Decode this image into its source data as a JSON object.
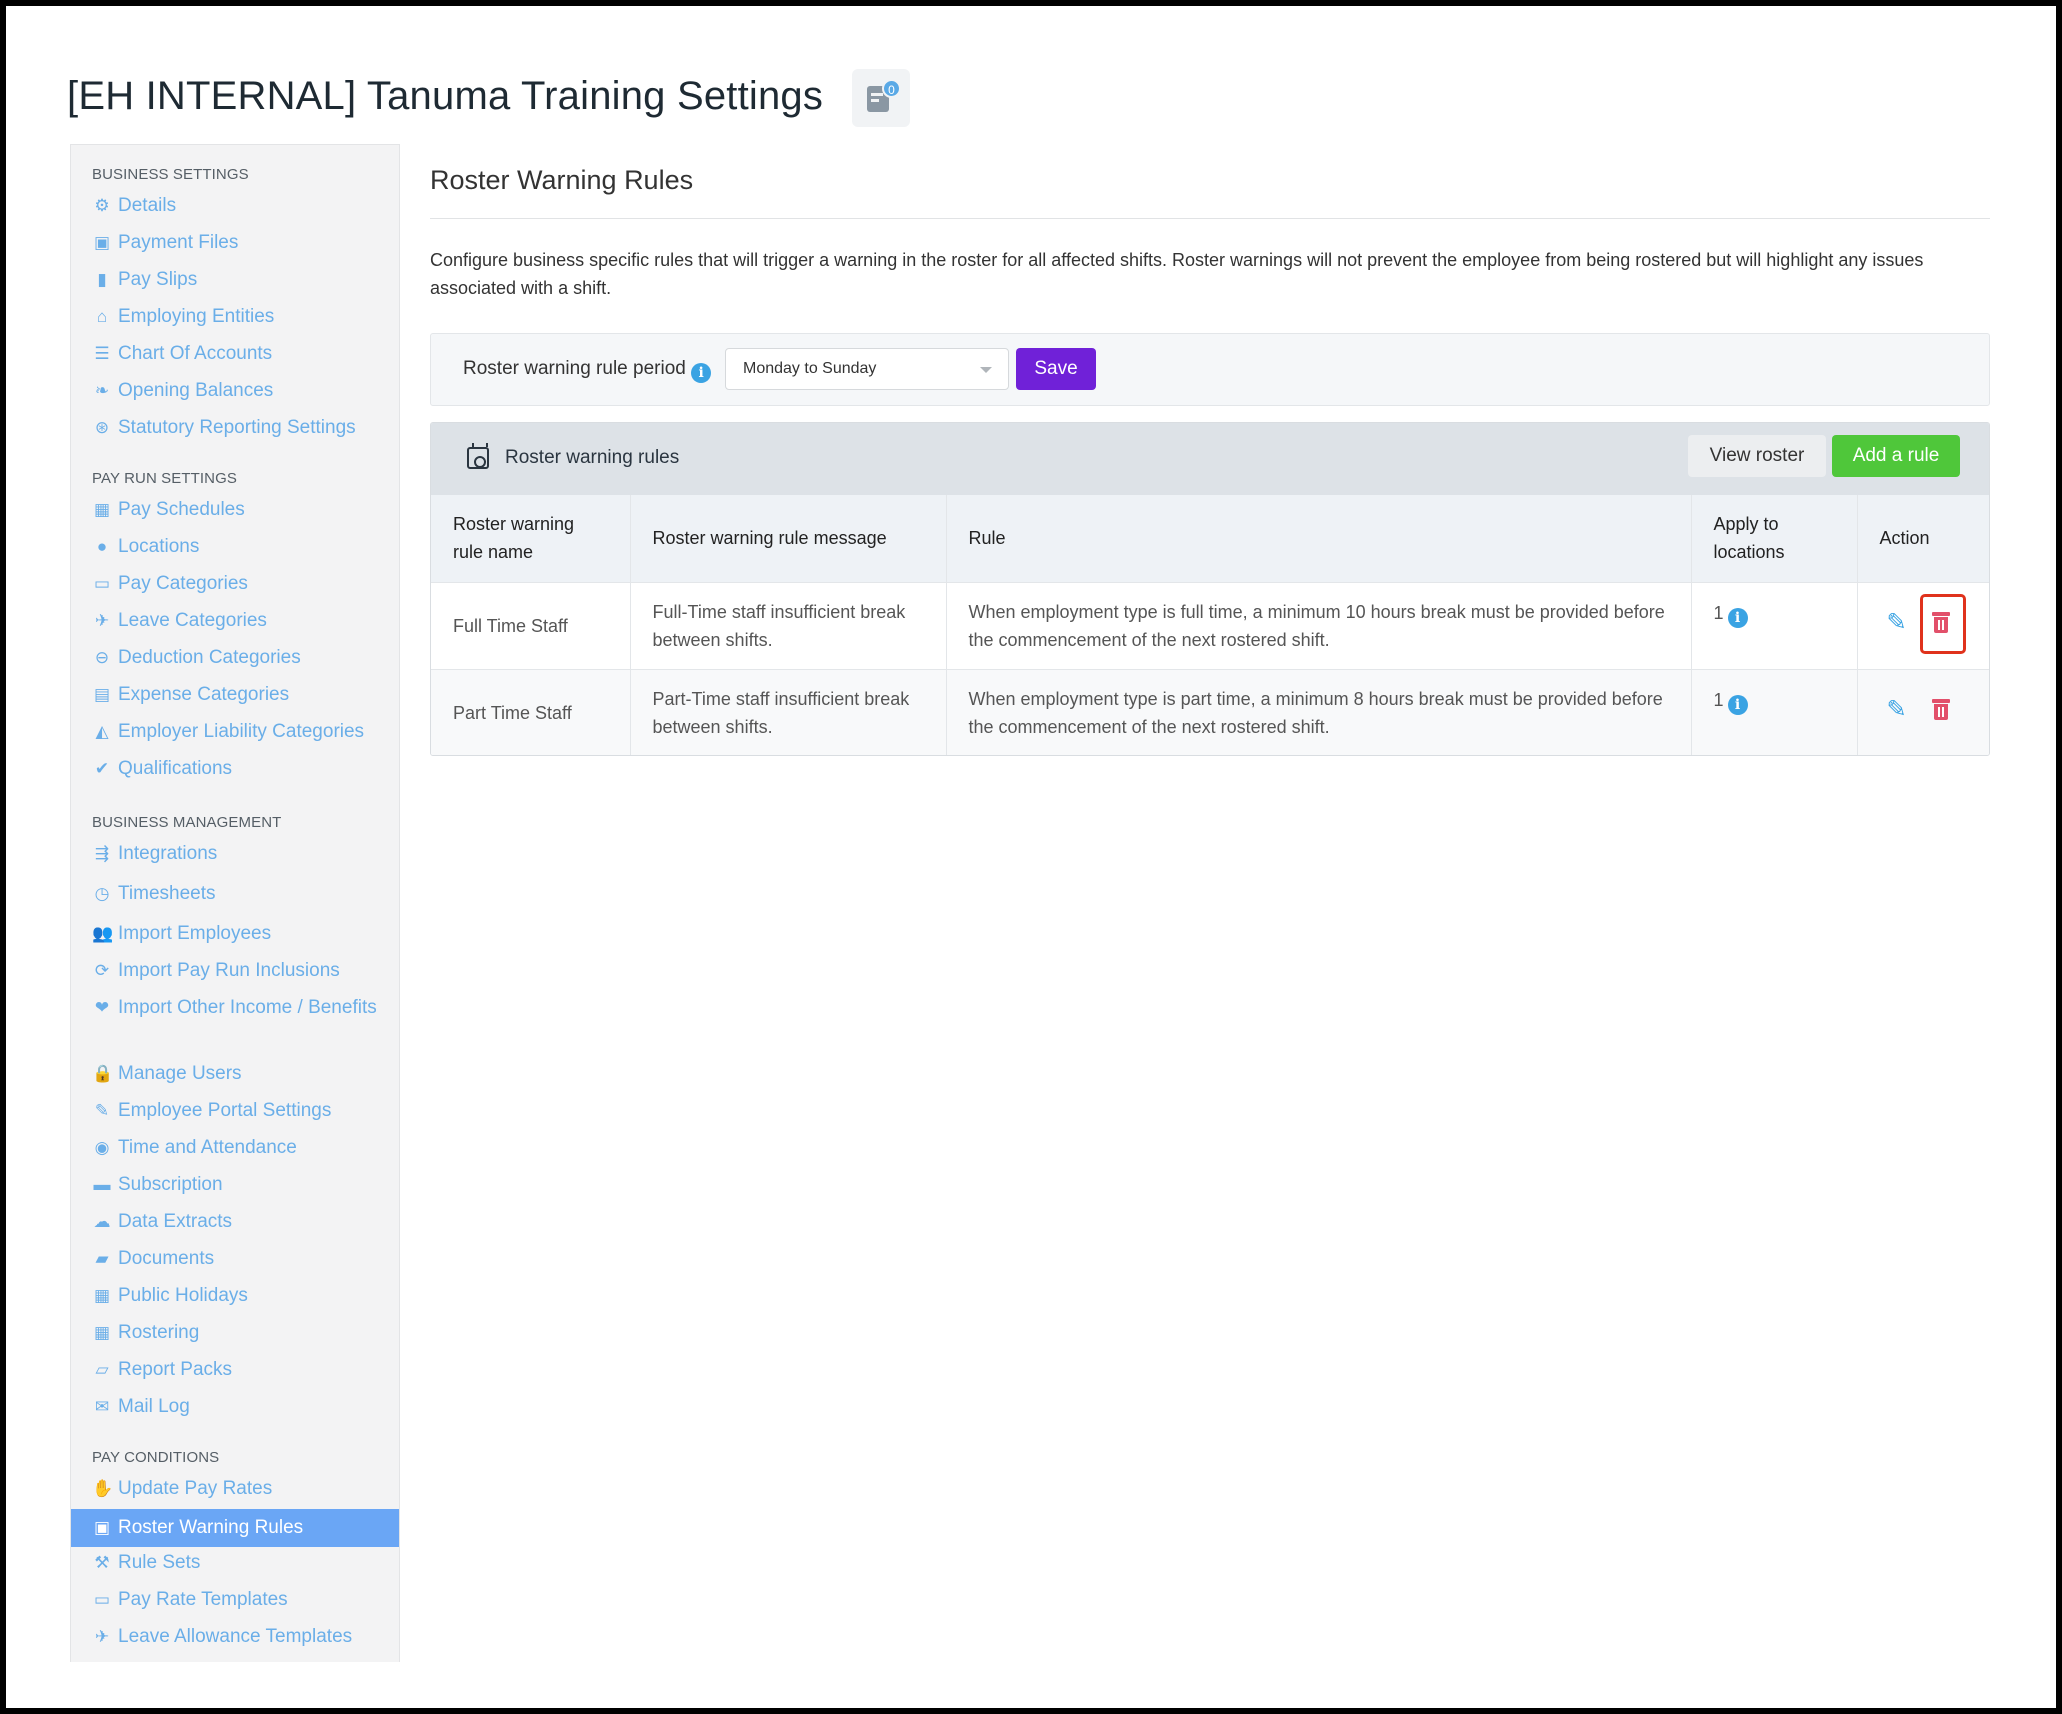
{
  "header": {
    "title": "[EH INTERNAL] Tanuma Training Settings",
    "notes_badge": "0"
  },
  "sidebar": {
    "sections": [
      {
        "label": "BUSINESS SETTINGS",
        "items": [
          {
            "label": "Details",
            "icon": "gear-icon",
            "glyph": "⚙"
          },
          {
            "label": "Payment Files",
            "icon": "floppy-icon",
            "glyph": "▣"
          },
          {
            "label": "Pay Slips",
            "icon": "file-icon",
            "glyph": "▮"
          },
          {
            "label": "Employing Entities",
            "icon": "bank-icon",
            "glyph": "⌂"
          },
          {
            "label": "Chart Of Accounts",
            "icon": "list-icon",
            "glyph": "☰"
          },
          {
            "label": "Opening Balances",
            "icon": "leaf-icon",
            "glyph": "❧"
          },
          {
            "label": "Statutory Reporting Settings",
            "icon": "lifebuoy-icon",
            "glyph": "⊛"
          }
        ]
      },
      {
        "label": "PAY RUN SETTINGS",
        "items": [
          {
            "label": "Pay Schedules",
            "icon": "calendar-icon",
            "glyph": "▦"
          },
          {
            "label": "Locations",
            "icon": "globe-icon",
            "glyph": "●"
          },
          {
            "label": "Pay Categories",
            "icon": "money-icon",
            "glyph": "▭"
          },
          {
            "label": "Leave Categories",
            "icon": "plane-icon",
            "glyph": "✈"
          },
          {
            "label": "Deduction Categories",
            "icon": "minus-circle-icon",
            "glyph": "⊖"
          },
          {
            "label": "Expense Categories",
            "icon": "archive-icon",
            "glyph": "▤"
          },
          {
            "label": "Employer Liability Categories",
            "icon": "area-chart-icon",
            "glyph": "◭"
          },
          {
            "label": "Qualifications",
            "icon": "check-icon",
            "glyph": "✔"
          }
        ]
      },
      {
        "label": "BUSINESS MANAGEMENT",
        "items": [
          {
            "label": "Integrations",
            "icon": "share-icon",
            "glyph": "⇶"
          },
          {
            "label": "Timesheets",
            "icon": "clock-icon",
            "glyph": "◷"
          },
          {
            "label": "Import Employees",
            "icon": "users-icon",
            "glyph": "👥"
          },
          {
            "label": "Import Pay Run Inclusions",
            "icon": "refresh-icon",
            "glyph": "⟳"
          },
          {
            "label": "Import Other Income / Benefits",
            "icon": "hand-heart-icon",
            "glyph": "❤"
          },
          {
            "label": "Manage Users",
            "icon": "lock-icon",
            "glyph": "🔒"
          },
          {
            "label": "Employee Portal Settings",
            "icon": "magic-wand-icon",
            "glyph": "✎"
          },
          {
            "label": "Time and Attendance",
            "icon": "user-circle-icon",
            "glyph": "◉"
          },
          {
            "label": "Subscription",
            "icon": "credit-card-icon",
            "glyph": "▬"
          },
          {
            "label": "Data Extracts",
            "icon": "cloud-download-icon",
            "glyph": "☁"
          },
          {
            "label": "Documents",
            "icon": "folder-icon",
            "glyph": "▰"
          },
          {
            "label": "Public Holidays",
            "icon": "calendar-icon",
            "glyph": "▦"
          },
          {
            "label": "Rostering",
            "icon": "calendar-icon",
            "glyph": "▦"
          },
          {
            "label": "Report Packs",
            "icon": "folder-open-icon",
            "glyph": "▱"
          },
          {
            "label": "Mail Log",
            "icon": "envelope-icon",
            "glyph": "✉"
          }
        ]
      },
      {
        "label": "PAY CONDITIONS",
        "items": [
          {
            "label": "Update Pay Rates",
            "icon": "hand-money-icon",
            "glyph": "✋"
          },
          {
            "label": "Roster Warning Rules",
            "icon": "calendar-clock-icon",
            "glyph": "▣",
            "active": true
          },
          {
            "label": "Rule Sets",
            "icon": "gavel-icon",
            "glyph": "⚒"
          },
          {
            "label": "Pay Rate Templates",
            "icon": "money-icon",
            "glyph": "▭"
          },
          {
            "label": "Leave Allowance Templates",
            "icon": "plane-icon",
            "glyph": "✈"
          }
        ]
      }
    ]
  },
  "main": {
    "title": "Roster Warning Rules",
    "description": "Configure business specific rules that will trigger a warning in the roster for all affected shifts. Roster warnings will not prevent the employee from being rostered but will highlight any issues associated with a shift.",
    "period": {
      "label": "Roster warning rule period",
      "selected": "Monday to Sunday",
      "save_label": "Save"
    },
    "rules_panel": {
      "title": "Roster warning rules",
      "view_roster_label": "View roster",
      "add_rule_label": "Add a rule",
      "columns": [
        "Roster warning rule name",
        "Roster warning rule message",
        "Rule",
        "Apply to locations",
        "Action"
      ],
      "rows": [
        {
          "name": "Full Time Staff",
          "message": "Full-Time staff insufficient break between shifts.",
          "rule": "When employment type is full time, a minimum 10 hours break must be provided before the commencement of the next rostered shift.",
          "locations": "1"
        },
        {
          "name": "Part Time Staff",
          "message": "Part-Time staff insufficient break between shifts.",
          "rule": "When employment type is part time, a minimum 8 hours break must be provided before the commencement of the next rostered shift.",
          "locations": "1"
        }
      ]
    }
  },
  "colors": {
    "link": "#6aaee8",
    "active": "#6aa6f5",
    "save": "#7021d8",
    "add": "#4fc73a",
    "delete": "#e2506a",
    "highlight": "#e0321c"
  }
}
